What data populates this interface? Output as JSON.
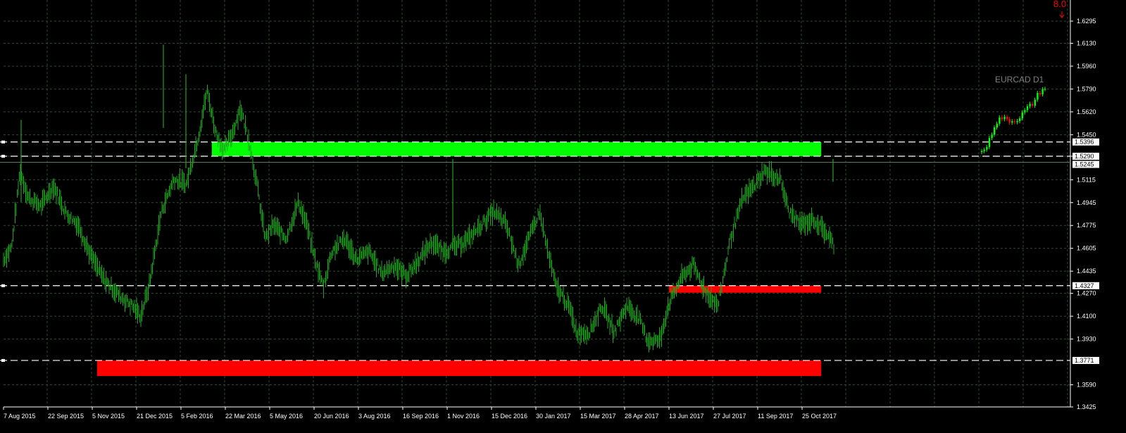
{
  "window": {
    "symbol_label": "EURCAD D1",
    "top_value": "8.0"
  },
  "chart_data": {
    "type": "candlestick",
    "timeframe": "D1",
    "symbol": "EURCAD",
    "y_axis": {
      "min": 1.3425,
      "max": 1.6295,
      "ticks": [
        "1.6295",
        "1.6130",
        "1.5960",
        "1.5790",
        "1.5620",
        "1.5450",
        "1.5290",
        "1.5115",
        "1.4945",
        "1.4775",
        "1.4605",
        "1.4435",
        "1.4270",
        "1.4100",
        "1.3930",
        "1.3590",
        "1.3425"
      ]
    },
    "x_axis": {
      "labels": [
        "7 Aug 2015",
        "22 Sep 2015",
        "5 Nov 2015",
        "21 Dec 2015",
        "5 Feb 2016",
        "22 Mar 2016",
        "5 May 2016",
        "20 Jun 2016",
        "3 Aug 2016",
        "16 Sep 2016",
        "1 Nov 2016",
        "15 Dec 2016",
        "30 Jan 2017",
        "15 Mar 2017",
        "28 Apr 2017",
        "13 Jun 2017",
        "27 Jul 2017",
        "11 Sep 2017",
        "25 Oct 2017"
      ]
    },
    "price_curve": [
      [
        0,
        1.452
      ],
      [
        0.01,
        1.462
      ],
      [
        0.02,
        1.518
      ],
      [
        0.03,
        1.498
      ],
      [
        0.045,
        1.492
      ],
      [
        0.06,
        1.507
      ],
      [
        0.075,
        1.487
      ],
      [
        0.09,
        1.478
      ],
      [
        0.105,
        1.455
      ],
      [
        0.12,
        1.438
      ],
      [
        0.14,
        1.425
      ],
      [
        0.155,
        1.418
      ],
      [
        0.165,
        1.41
      ],
      [
        0.175,
        1.432
      ],
      [
        0.19,
        1.488
      ],
      [
        0.205,
        1.512
      ],
      [
        0.22,
        1.508
      ],
      [
        0.235,
        1.545
      ],
      [
        0.245,
        1.578
      ],
      [
        0.255,
        1.548
      ],
      [
        0.265,
        1.533
      ],
      [
        0.275,
        1.545
      ],
      [
        0.285,
        1.565
      ],
      [
        0.295,
        1.542
      ],
      [
        0.305,
        1.508
      ],
      [
        0.315,
        1.468
      ],
      [
        0.325,
        1.478
      ],
      [
        0.34,
        1.468
      ],
      [
        0.355,
        1.495
      ],
      [
        0.365,
        1.478
      ],
      [
        0.375,
        1.452
      ],
      [
        0.385,
        1.432
      ],
      [
        0.395,
        1.458
      ],
      [
        0.41,
        1.468
      ],
      [
        0.425,
        1.452
      ],
      [
        0.44,
        1.458
      ],
      [
        0.455,
        1.442
      ],
      [
        0.47,
        1.448
      ],
      [
        0.485,
        1.44
      ],
      [
        0.5,
        1.452
      ],
      [
        0.515,
        1.465
      ],
      [
        0.53,
        1.458
      ],
      [
        0.545,
        1.462
      ],
      [
        0.56,
        1.468
      ],
      [
        0.575,
        1.478
      ],
      [
        0.59,
        1.488
      ],
      [
        0.605,
        1.478
      ],
      [
        0.62,
        1.448
      ],
      [
        0.635,
        1.472
      ],
      [
        0.645,
        1.488
      ],
      [
        0.655,
        1.458
      ],
      [
        0.665,
        1.432
      ],
      [
        0.68,
        1.418
      ],
      [
        0.69,
        1.398
      ],
      [
        0.705,
        1.398
      ],
      [
        0.72,
        1.418
      ],
      [
        0.735,
        1.398
      ],
      [
        0.75,
        1.418
      ],
      [
        0.765,
        1.408
      ],
      [
        0.775,
        1.392
      ],
      [
        0.79,
        1.392
      ],
      [
        0.8,
        1.418
      ],
      [
        0.815,
        1.438
      ],
      [
        0.83,
        1.448
      ],
      [
        0.845,
        1.428
      ],
      [
        0.86,
        1.418
      ],
      [
        0.875,
        1.468
      ],
      [
        0.89,
        1.498
      ],
      [
        0.905,
        1.508
      ],
      [
        0.915,
        1.518
      ],
      [
        0.925,
        1.515
      ],
      [
        0.935,
        1.512
      ],
      [
        0.945,
        1.488
      ],
      [
        0.96,
        1.478
      ],
      [
        0.975,
        1.482
      ],
      [
        0.99,
        1.472
      ],
      [
        1.0,
        1.462
      ]
    ],
    "right_segment": [
      [
        0,
        1.532
      ],
      [
        0.1,
        1.538
      ],
      [
        0.2,
        1.552
      ],
      [
        0.3,
        1.558
      ],
      [
        0.4,
        1.556
      ],
      [
        0.5,
        1.555
      ],
      [
        0.6,
        1.558
      ],
      [
        0.7,
        1.564
      ],
      [
        0.8,
        1.568
      ],
      [
        0.9,
        1.576
      ],
      [
        1.0,
        1.58
      ]
    ],
    "second_segment": [
      [
        0,
        1.445
      ],
      [
        0.05,
        1.458
      ],
      [
        0.1,
        1.455
      ],
      [
        0.15,
        1.468
      ],
      [
        0.2,
        1.488
      ],
      [
        0.25,
        1.495
      ],
      [
        0.3,
        1.49
      ],
      [
        0.35,
        1.478
      ],
      [
        0.4,
        1.488
      ],
      [
        0.45,
        1.498
      ],
      [
        0.5,
        1.492
      ],
      [
        0.55,
        1.468
      ],
      [
        0.6,
        1.455
      ],
      [
        0.65,
        1.452
      ],
      [
        0.7,
        1.468
      ],
      [
        0.75,
        1.47
      ],
      [
        0.8,
        1.478
      ],
      [
        0.85,
        1.492
      ],
      [
        0.9,
        1.488
      ],
      [
        0.95,
        1.508
      ],
      [
        1.0,
        1.525
      ]
    ],
    "levels": [
      {
        "price": 1.5396,
        "label": "1.5396",
        "style": "dashed",
        "tagged": true
      },
      {
        "price": 1.529,
        "label": "1.5290",
        "style": "dashed",
        "tagged": true
      },
      {
        "price": 1.5245,
        "label": "1.5245",
        "style": "solid",
        "tagged": true
      },
      {
        "price": 1.4327,
        "label": "1.4327",
        "style": "dashed",
        "tagged": true
      },
      {
        "price": 1.3771,
        "label": "1.3771",
        "style": "dashed",
        "tagged": true
      }
    ],
    "zones": [
      {
        "color": "#00ff00",
        "price_top": 1.5396,
        "price_bottom": 1.529,
        "x_start_date": "8 Mar 2016",
        "x_end_date": "13 Nov 2017"
      },
      {
        "color": "#ff0000",
        "price_top": 1.4327,
        "price_bottom": 1.4275,
        "x_start_date": "13 Jun 2017",
        "x_end_date": "13 Nov 2017"
      },
      {
        "color": "#ff0000",
        "price_top": 1.3771,
        "price_bottom": 1.3655,
        "x_start_date": "10 Nov 2015",
        "x_end_date": "13 Nov 2017"
      }
    ],
    "colors": {
      "background": "#000000",
      "grid": "#2c4d2c",
      "candle": "#00ff00",
      "bar": "#1fa31f",
      "bear": "#ff0000",
      "level_line": "#ffffff",
      "axis_text": "#ffffff",
      "symbol_text": "#7f7f7f"
    },
    "grid": true
  }
}
